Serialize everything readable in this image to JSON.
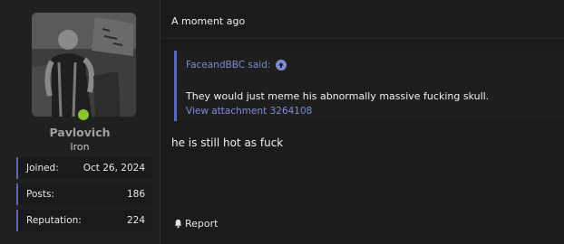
{
  "post": {
    "timestamp": "A moment ago",
    "quote": {
      "author_label": "FaceandBBC said:",
      "text": "They would just meme his abnormally massive fucking skull.",
      "attachment_link": "View attachment 3264108"
    },
    "message": "he is still hot as fuck",
    "actions": {
      "report_label": "Report"
    }
  },
  "user": {
    "username": "Pavlovich",
    "rank": "Iron",
    "online_status_color": "#87c52b",
    "stats": [
      {
        "label": "Joined:",
        "value": "Oct 26, 2024"
      },
      {
        "label": "Posts:",
        "value": "186"
      },
      {
        "label": "Reputation:",
        "value": "224"
      }
    ]
  },
  "colors": {
    "accent": "#5b67b6",
    "link": "#7f8bd3"
  },
  "icons": {
    "quote_jump": "arrow-up-circle-icon",
    "report": "bell-icon"
  }
}
